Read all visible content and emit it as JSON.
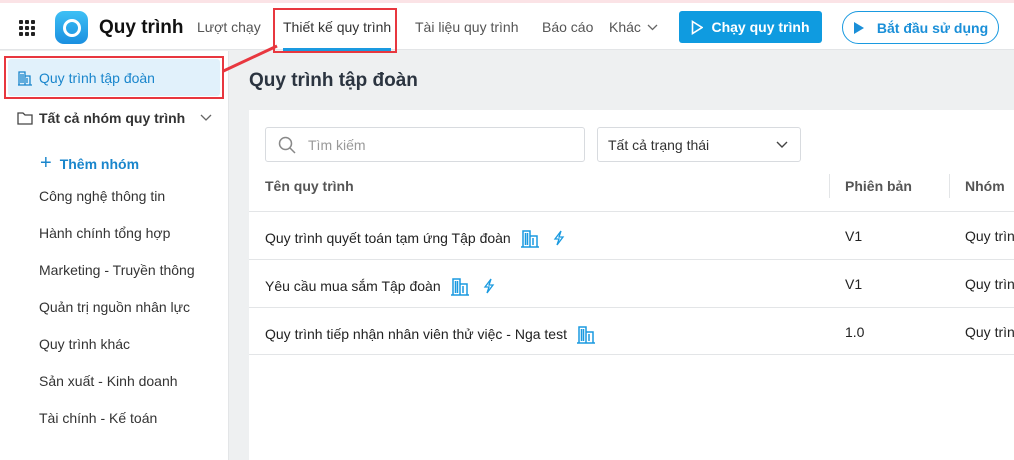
{
  "header": {
    "app_title": "Quy trình",
    "nav": [
      "Lượt chạy",
      "Thiết kế quy trình",
      "Tài liệu quy trình",
      "Báo cáo",
      "Khác"
    ],
    "run_button": "Chạy quy trình",
    "start_button": "Bắt đầu sử dụng"
  },
  "sidebar": {
    "active": "Quy trình tập đoàn",
    "group": "Tất cả nhóm quy trình",
    "add": "Thêm nhóm",
    "items": [
      "Công nghệ thông tin",
      "Hành chính tổng hợp",
      "Marketing - Truyền thông",
      "Quản trị nguồn nhân lực",
      "Quy trình khác",
      "Sản xuất - Kinh doanh",
      "Tài chính - Kế toán"
    ]
  },
  "main": {
    "title": "Quy trình tập đoàn",
    "search_placeholder": "Tìm kiếm",
    "status_filter": "Tất cả trạng thái",
    "columns": [
      "Tên quy trình",
      "Phiên bản",
      "Nhóm"
    ],
    "rows": [
      {
        "name": "Quy trình quyết toán tạm ứng Tập đoàn",
        "version": "V1",
        "group": "Quy trìn"
      },
      {
        "name": "Yêu cầu mua sắm Tập đoàn",
        "version": "V1",
        "group": "Quy trìn"
      },
      {
        "name": "Quy trình tiếp nhận nhân viên thử việc - Nga test",
        "version": "1.0",
        "group": "Quy trìn"
      }
    ]
  },
  "colors": {
    "accent": "#0f9be0",
    "highlight": "#e8373f"
  }
}
